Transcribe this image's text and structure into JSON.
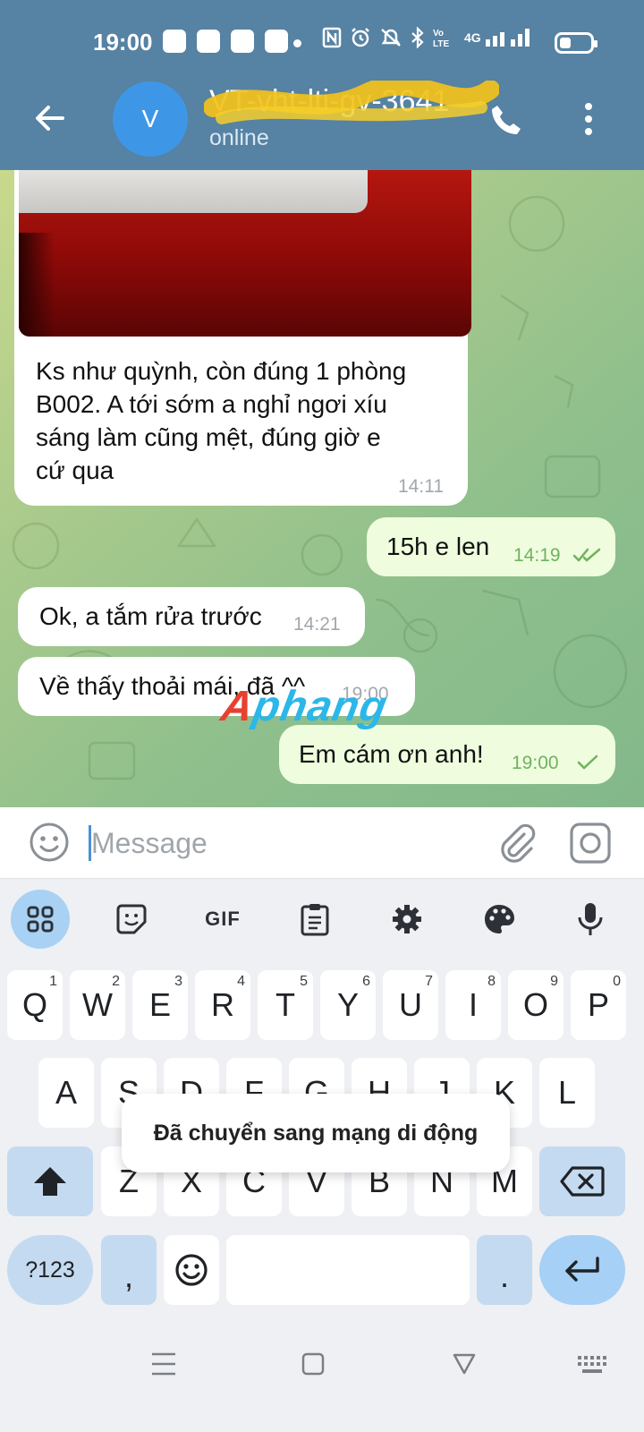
{
  "status_bar": {
    "time": "19:00",
    "network": "4G"
  },
  "header": {
    "avatar_letter": "V",
    "title": "VT-vht-lti-gv-3641",
    "subtitle": "online"
  },
  "messages": [
    {
      "direction": "incoming",
      "has_photo": true,
      "text": [
        "Ks như quỳnh, còn đúng 1 phòng",
        "B002. A tới sớm a nghỉ ngơi xíu",
        "sáng làm cũng mệt, đúng giờ e",
        "cứ qua"
      ],
      "time": "14:11"
    },
    {
      "direction": "outgoing",
      "text": "15h e len",
      "time": "14:19",
      "status": "read"
    },
    {
      "direction": "incoming",
      "text": "Ok, a tắm rửa trước",
      "time": "14:21"
    },
    {
      "direction": "incoming",
      "text": "Về thấy thoải mái, đã ^^",
      "time": "19:00"
    },
    {
      "direction": "outgoing",
      "text": "Em cám ơn anh!",
      "time": "19:00",
      "status": "sent"
    }
  ],
  "watermark": {
    "part1": "A",
    "part2": "phang"
  },
  "input": {
    "placeholder": "Message"
  },
  "keyboard": {
    "toolbar": [
      "apps-grid",
      "sticker",
      "GIF",
      "clipboard",
      "settings",
      "theme",
      "microphone"
    ],
    "gif_label": "GIF",
    "row1": [
      "Q",
      "W",
      "E",
      "R",
      "T",
      "Y",
      "U",
      "I",
      "O",
      "P"
    ],
    "row1_hints": [
      "1",
      "2",
      "3",
      "4",
      "5",
      "6",
      "7",
      "8",
      "9",
      "0"
    ],
    "row2": [
      "A",
      "S",
      "D",
      "F",
      "G",
      "H",
      "J",
      "K",
      "L"
    ],
    "row3": [
      "Z",
      "X",
      "C",
      "V",
      "B",
      "N",
      "M"
    ],
    "symbols_label": "?123",
    "comma": ",",
    "period": "."
  },
  "toast": "Đã chuyển sang mạng di động",
  "colors": {
    "header": "#5682a3",
    "incoming_bubble": "#ffffff",
    "outgoing_bubble": "#effdde",
    "accent": "#3e97e6"
  }
}
